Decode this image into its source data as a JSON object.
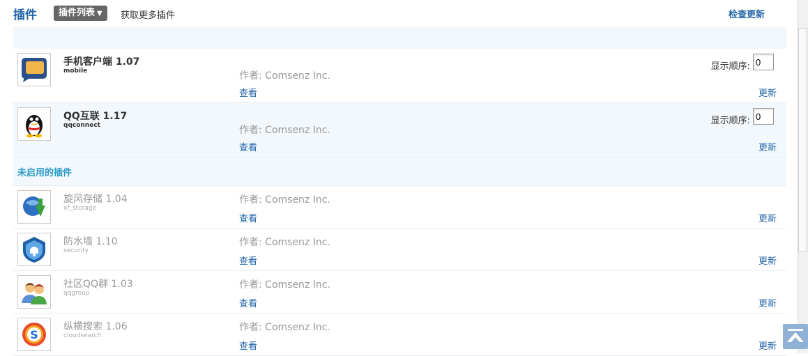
{
  "header": {
    "title": "插件",
    "tab_current": "插件列表",
    "tab_more": "获取更多插件",
    "check_update": "检查更新"
  },
  "enabled_plugins": [
    {
      "name": "手机客户端 1.07",
      "id": "mobile",
      "author": "作者: Comsenz Inc.",
      "view": "查看",
      "update": "更新",
      "order_label": "显示顺序:",
      "order_value": "0",
      "icon": "chat-bubble-icon"
    },
    {
      "name": "QQ互联 1.17",
      "id": "qqconnect",
      "author": "作者: Comsenz Inc.",
      "view": "查看",
      "update": "更新",
      "order_label": "显示顺序:",
      "order_value": "0",
      "icon": "penguin-icon"
    }
  ],
  "disabled_section_title": "未启用的插件",
  "disabled_plugins": [
    {
      "name": "旋风存储 1.04",
      "id": "xf_storage",
      "author": "作者: Comsenz Inc.",
      "view": "查看",
      "update": "更新",
      "icon": "globe-download-icon"
    },
    {
      "name": "防水墙 1.10",
      "id": "security",
      "author": "作者: Comsenz Inc.",
      "view": "查看",
      "update": "更新",
      "icon": "shield-icon"
    },
    {
      "name": "社区QQ群 1.03",
      "id": "qqgroup",
      "author": "作者: Comsenz Inc.",
      "view": "查看",
      "update": "更新",
      "icon": "users-group-icon"
    },
    {
      "name": "纵横搜索 1.06",
      "id": "cloudsearch",
      "author": "作者: Comsenz Inc.",
      "view": "查看",
      "update": "更新",
      "icon": "search-s-icon"
    }
  ],
  "colors": {
    "link": "#2366a8",
    "section": "#2b9bc8",
    "alt_row": "#f2f8fc",
    "tab_bg": "#666666"
  }
}
